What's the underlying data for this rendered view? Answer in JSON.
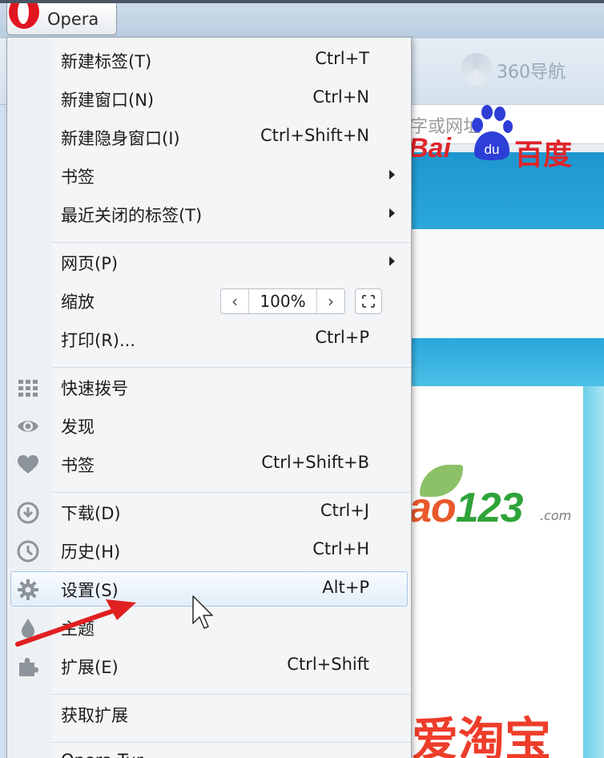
{
  "window": {
    "opera_button_label": "Opera",
    "tab_title": "360导航",
    "address_placeholder": "字或网址"
  },
  "menu": {
    "items": [
      {
        "label": "新建标签(T)",
        "shortcut": "Ctrl+T"
      },
      {
        "label": "新建窗口(N)",
        "shortcut": "Ctrl+N"
      },
      {
        "label": "新建隐身窗口(I)",
        "shortcut": "Ctrl+Shift+N"
      },
      {
        "label": "书签",
        "shortcut": ""
      },
      {
        "label": "最近关闭的标签(T)",
        "shortcut": ""
      },
      {
        "label": "网页(P)",
        "shortcut": ""
      },
      {
        "label": "缩放",
        "shortcut": ""
      },
      {
        "label": "打印(R)...",
        "shortcut": "Ctrl+P"
      },
      {
        "label": "快速拨号",
        "shortcut": ""
      },
      {
        "label": "发现",
        "shortcut": ""
      },
      {
        "label": "书签",
        "shortcut": "Ctrl+Shift+B"
      },
      {
        "label": "下载(D)",
        "shortcut": "Ctrl+J"
      },
      {
        "label": "历史(H)",
        "shortcut": "Ctrl+H"
      },
      {
        "label": "设置(S)",
        "shortcut": "Alt+P"
      },
      {
        "label": "主题",
        "shortcut": ""
      },
      {
        "label": "扩展(E)",
        "shortcut": "Ctrl+Shift"
      },
      {
        "label": "获取扩展",
        "shortcut": ""
      },
      {
        "label": "Opera Tur",
        "shortcut": ""
      }
    ],
    "zoom": {
      "minus": "‹",
      "value": "100%",
      "plus": "›"
    },
    "selected_item": "设置(S)"
  },
  "page": {
    "baidu_latin": "Bai",
    "baidu_paw_text": "du",
    "baidu_cn": "百度",
    "hao_prefix": "ao",
    "hao_numbers": "123",
    "hao_suffix": ".com",
    "taobao": "爱淘宝"
  },
  "colors": {
    "accent_red": "#e2161f",
    "menu_bg": "#f3f5f7",
    "highlight_border": "#a9c6e3"
  }
}
